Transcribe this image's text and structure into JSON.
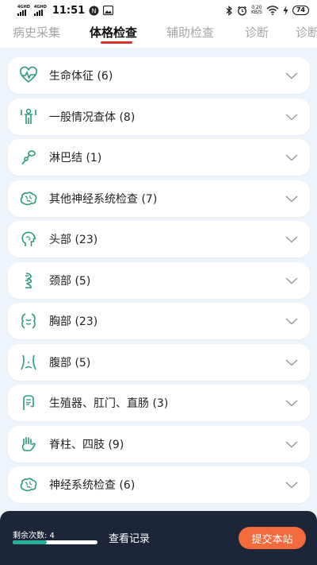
{
  "status_bar": {
    "signal1_label": "4GHD",
    "signal2_label": "4GHD",
    "time": "11:51",
    "notif_badge": "N",
    "speed_value": "0.20",
    "speed_unit": "KB/S",
    "battery": "74"
  },
  "tabs": [
    {
      "label": "病史采集"
    },
    {
      "label": "体格检查"
    },
    {
      "label": "辅助检查"
    },
    {
      "label": "诊断"
    },
    {
      "label": "诊断"
    }
  ],
  "active_tab": 1,
  "accent_color": "#2a9d76",
  "items": [
    {
      "label": "生命体征 (6)",
      "icon": "heartbeat-icon"
    },
    {
      "label": "一般情况查体 (8)",
      "icon": "body-figure-icon"
    },
    {
      "label": "淋巴结 (1)",
      "icon": "lymph-node-icon"
    },
    {
      "label": "其他神经系统检查 (7)",
      "icon": "brain-icon"
    },
    {
      "label": "头部 (23)",
      "icon": "head-icon"
    },
    {
      "label": "颈部 (5)",
      "icon": "neck-icon"
    },
    {
      "label": "胸部 (23)",
      "icon": "chest-icon"
    },
    {
      "label": "腹部 (5)",
      "icon": "abdomen-icon"
    },
    {
      "label": "生殖器、肛门、直肠 (3)",
      "icon": "intestine-icon"
    },
    {
      "label": "脊柱、四肢 (9)",
      "icon": "hand-icon"
    },
    {
      "label": "神经系统检查 (6)",
      "icon": "brain-icon"
    }
  ],
  "bottom": {
    "remaining_label": "剩余次数: 4",
    "progress_fraction": 0.4,
    "view_records": "查看记录",
    "submit": "提交本站"
  }
}
